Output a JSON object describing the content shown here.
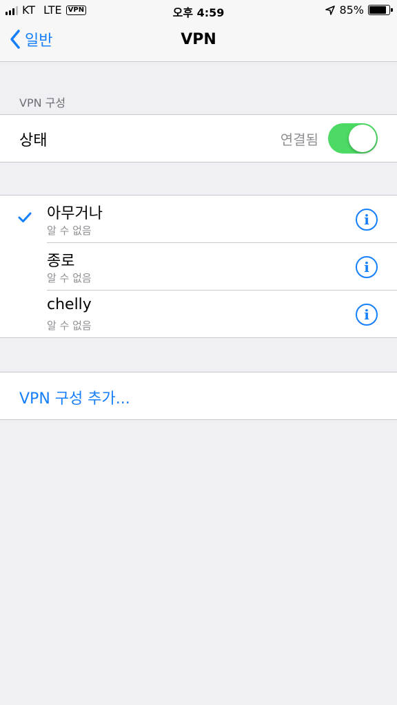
{
  "status_bar": {
    "carrier": "KT",
    "network": "LTE",
    "vpn_badge": "VPN",
    "time": "오후 4:59",
    "battery_percent": "85%",
    "battery_level": 0.85
  },
  "nav": {
    "back_label": "일반",
    "title": "VPN"
  },
  "section_header": "VPN 구성",
  "status_row": {
    "label": "상태",
    "value": "연결됨",
    "toggle_on": true
  },
  "vpn_list": [
    {
      "name": "아무거나",
      "subtitle": "알 수 없음",
      "selected": true
    },
    {
      "name": "종로",
      "subtitle": "알 수 없음",
      "selected": false
    },
    {
      "name": "chelly",
      "subtitle": "알 수 없음",
      "selected": false
    }
  ],
  "add_config_label": "VPN 구성 추가...",
  "icons": {
    "back": "chevron-left-icon",
    "check": "checkmark-icon",
    "info": "info-icon",
    "location": "location-arrow-icon"
  },
  "colors": {
    "accent": "#147efb",
    "toggle_on": "#4cd964",
    "background": "#efeff4"
  }
}
